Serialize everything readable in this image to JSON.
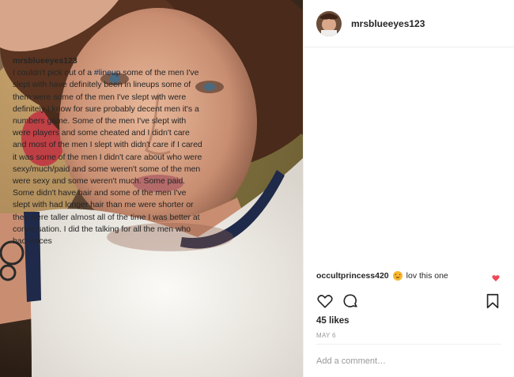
{
  "post": {
    "username": "mrsblueeyes123",
    "caption": {
      "username": "mrsblueeyes123",
      "text_before_tag": "I couldn't pick out of a ",
      "hashtag": "#lineup",
      "text_after_tag": " some of the men I've slept with have definitely been in lineups some of them were some of the men I've slept with were definitely I know for sure probably decent men it's a numbers game. Some of the men I've slept with were players and some cheated and I didn't care and most of the men I slept with didn't care if I cared it was some of the men I didn't care about who were sexy/much/paid and some weren't some of the men were sexy and some weren't much. Some paid. Some didn't have hair and some of the men I've slept with had longer hair than me were shorter or they were taller almost all of the time I was better at conversation. I did the talking for all the men who had voices"
    },
    "comment": {
      "username": "occultprincess420",
      "emoji": "heart-eyes-emoji",
      "text": "lov this one"
    },
    "likes": "45 likes",
    "date": "MAY 6",
    "add_comment_placeholder": "Add a comment…"
  },
  "colors": {
    "like_red": "#ed4956",
    "hashtag_blue": "#003569",
    "muted": "#999999"
  },
  "icons": [
    "heart-icon",
    "comment-icon",
    "bookmark-icon",
    "small-heart-icon"
  ]
}
